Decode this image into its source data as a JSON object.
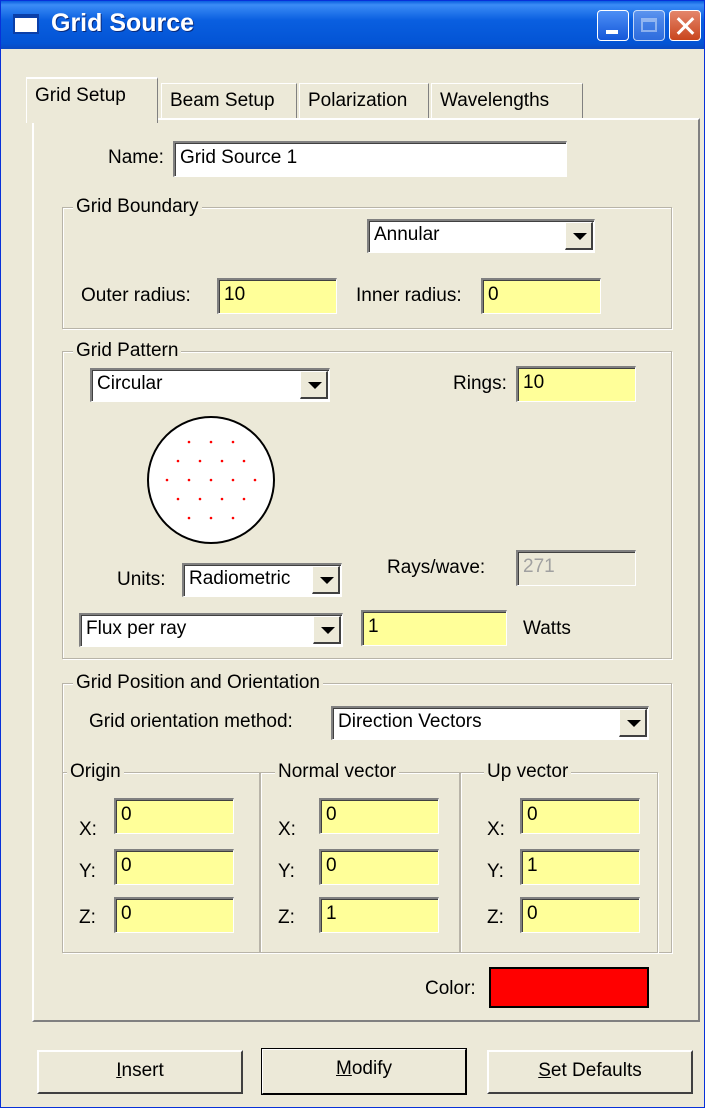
{
  "window": {
    "title": "Grid Source"
  },
  "tabs": [
    {
      "label": "Grid Setup",
      "active": true
    },
    {
      "label": "Beam Setup",
      "active": false
    },
    {
      "label": "Polarization",
      "active": false
    },
    {
      "label": "Wavelengths",
      "active": false
    }
  ],
  "name": {
    "label": "Name:",
    "value": "Grid Source 1"
  },
  "grid_boundary": {
    "title": "Grid Boundary",
    "shape": "Annular",
    "outer_radius": {
      "label": "Outer radius:",
      "value": "10"
    },
    "inner_radius": {
      "label": "Inner radius:",
      "value": "0"
    }
  },
  "grid_pattern": {
    "title": "Grid Pattern",
    "pattern": "Circular",
    "rings": {
      "label": "Rings:",
      "value": "10"
    },
    "units": {
      "label": "Units:",
      "value": "Radiometric"
    },
    "rays_per_wave": {
      "label": "Rays/wave:",
      "value": "271"
    },
    "flux": {
      "mode": "Flux per ray",
      "value": "1",
      "unit": "Watts"
    }
  },
  "grid_position": {
    "title": "Grid Position and Orientation",
    "method_label": "Grid orientation method:",
    "method": "Direction Vectors",
    "origin": {
      "title": "Origin",
      "x": "0",
      "y": "0",
      "z": "0"
    },
    "normal": {
      "title": "Normal vector",
      "x": "0",
      "y": "0",
      "z": "1"
    },
    "up": {
      "title": "Up vector",
      "x": "0",
      "y": "1",
      "z": "0"
    },
    "axis_labels": {
      "x": "X:",
      "y": "Y:",
      "z": "Z:"
    }
  },
  "color": {
    "label": "Color:",
    "value": "#ff0000"
  },
  "buttons": {
    "insert_first": "I",
    "insert_rest": "nsert",
    "modify_first": "M",
    "modify_rest": "odify",
    "defaults_first": "S",
    "defaults_rest": "et Defaults"
  },
  "colors": {
    "title_bar": "#0a5fe0",
    "dialog_bg": "#ece9d8",
    "input_highlight": "#ffff99",
    "ray_dot": "#ff0000"
  }
}
